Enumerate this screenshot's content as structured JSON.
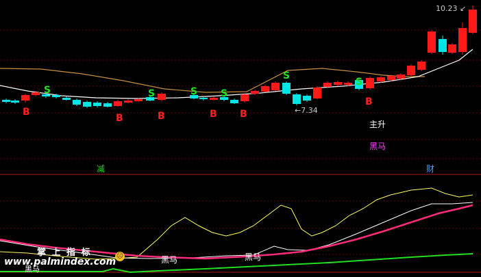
{
  "price_panel": {
    "high_label": "10.23",
    "low_label": "7.34",
    "high_arrow": "←",
    "low_arrow": "←",
    "buy_mark": "B",
    "sell_mark": "S",
    "text_main_rise": "主升",
    "text_black_horse": "黑马",
    "colors": {
      "bull": "#ff1a1a",
      "bear": "#00e5e5",
      "ma_white": "#ffffff",
      "ma_orange": "#c8a050",
      "grid_red": "#7a1010"
    }
  },
  "divider": {
    "left_tag": "减",
    "right_tag": "财",
    "left_tag_color": "#20d020",
    "right_tag_color": "#40a0ff"
  },
  "indicator_panel": {
    "label_black_horse": "黑马",
    "watermark_title": "掌 上 指 标",
    "watermark_url": "www.palmindex.com",
    "watermark_icon": "smiley-face-icon",
    "bottom_left_text": "黑马",
    "colors": {
      "yellow": "#ffff60",
      "white": "#ffffff",
      "magenta": "#ff2a7a",
      "green": "#20e020"
    }
  }
}
